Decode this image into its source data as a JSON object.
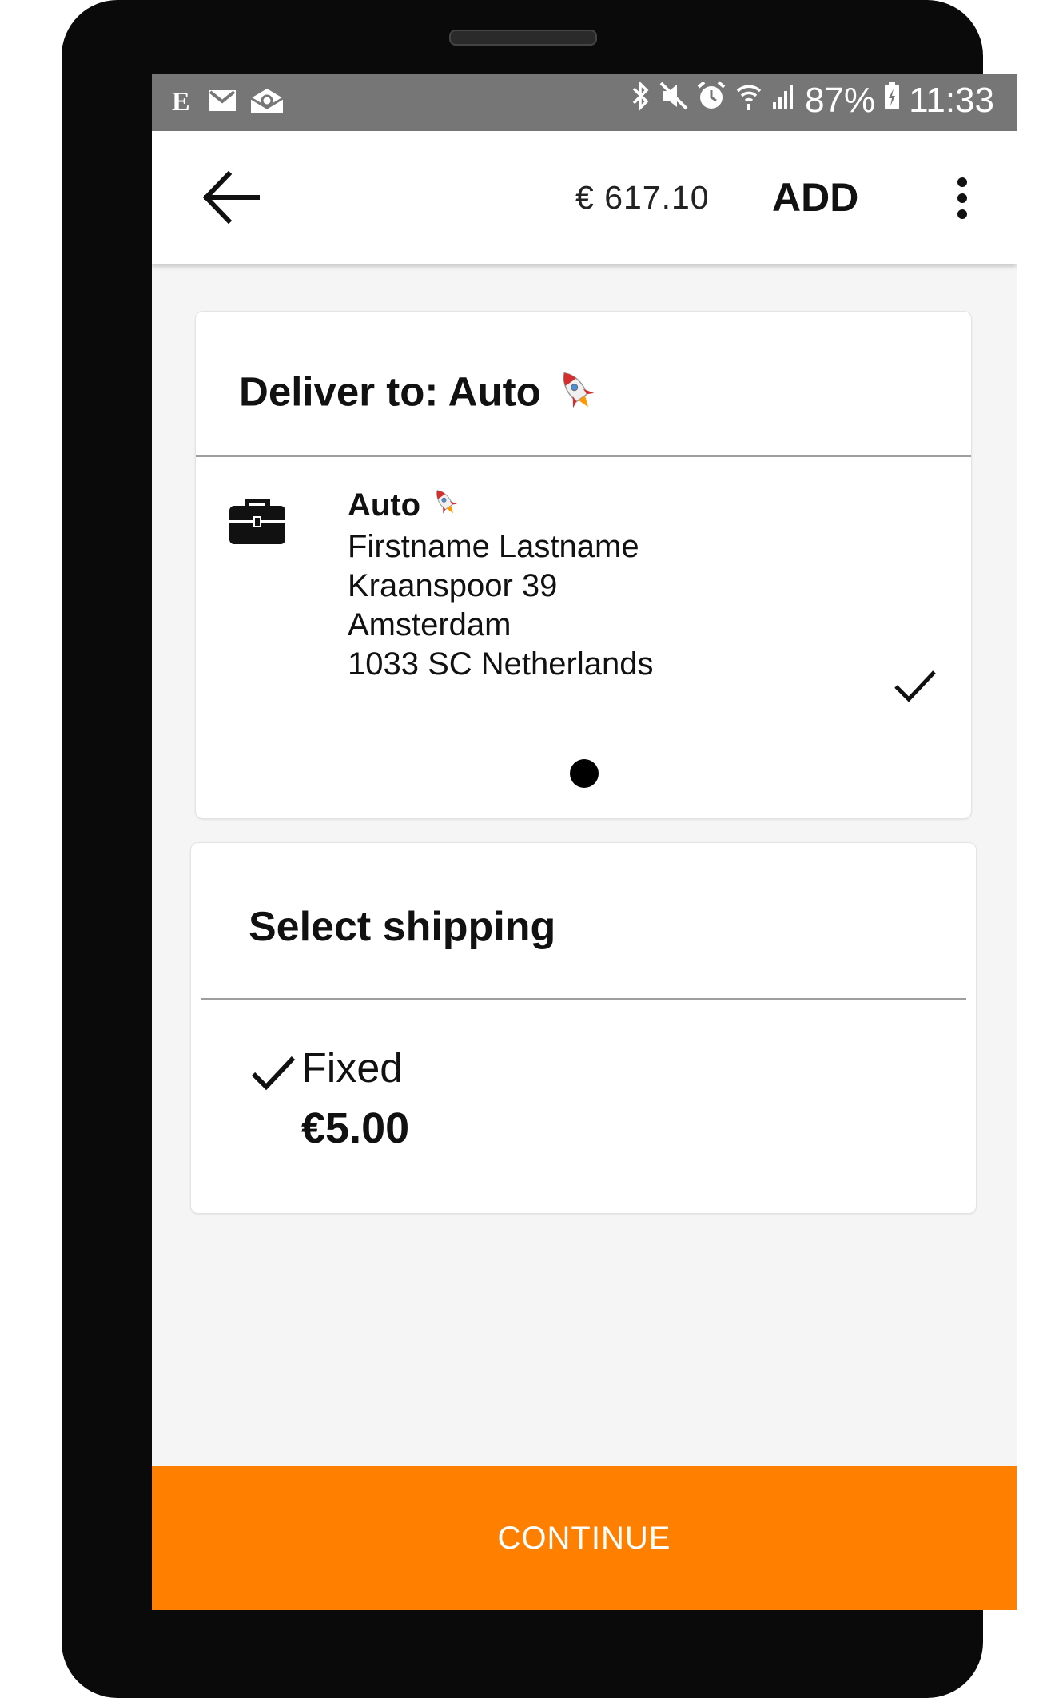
{
  "status_bar": {
    "left_icons": [
      "e-app-icon",
      "gmail-icon",
      "mail-icon"
    ],
    "right_icons": [
      "bluetooth-icon",
      "mute-icon",
      "alarm-icon",
      "wifi-icon",
      "signal-icon"
    ],
    "battery": "87%",
    "time": "11:33"
  },
  "app_bar": {
    "back_icon": "arrow-left-icon",
    "total": "€ 617.10",
    "add_label": "ADD",
    "menu_icon": "more-vert-icon"
  },
  "delivery_card": {
    "title": "Deliver to: Auto",
    "title_icon": "rocket-icon",
    "address_icon": "briefcase-icon",
    "address": {
      "name": "Auto",
      "person": "Firstname Lastname",
      "street": "Kraanspoor 39",
      "city": "Amsterdam",
      "postal_country": "1033 SC Netherlands"
    },
    "selected": true
  },
  "pager": {
    "pages": 1,
    "current": 1
  },
  "shipping_card": {
    "title": "Select shipping",
    "option": {
      "label": "Fixed",
      "price": "€5.00",
      "selected": true
    }
  },
  "footer": {
    "continue_label": "CONTINUE",
    "accent_color": "#ff7f00"
  }
}
